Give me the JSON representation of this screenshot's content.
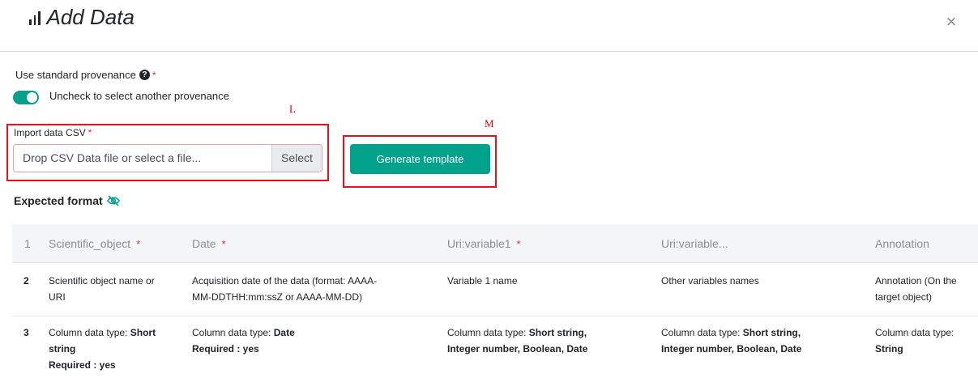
{
  "modal": {
    "title": "Add Data",
    "title_icon": "bar-chart-icon",
    "close_symbol": "×"
  },
  "provenance": {
    "label": "Use standard provenance",
    "required_mark": "*",
    "help_symbol": "?",
    "toggle_label": "Uncheck to select another provenance",
    "toggle_on": true
  },
  "annotations": {
    "L": "L",
    "M": "M"
  },
  "import": {
    "label": "Import data CSV",
    "required_mark": "*",
    "placeholder": "Drop CSV Data file or select a file...",
    "select_label": "Select"
  },
  "generate": {
    "label": "Generate template"
  },
  "expected": {
    "label": "Expected format",
    "icon": "eye-slash-icon"
  },
  "table": {
    "headers": [
      {
        "text": "1",
        "required": ""
      },
      {
        "text": "Scientific_object",
        "required": "*"
      },
      {
        "text": "Date",
        "required": "*"
      },
      {
        "text": "Uri:variable1",
        "required": "*"
      },
      {
        "text": "Uri:variable...",
        "required": ""
      },
      {
        "text": "Annotation",
        "required": ""
      }
    ],
    "row2": {
      "num": "2",
      "c1": [
        "Scientific object name or",
        "URI"
      ],
      "c2": [
        "Acquisition date of the data (format: AAAA-",
        "MM-DDTHH:mm:ssZ or AAAA-MM-DD)"
      ],
      "c3": "Variable 1 name",
      "c4": "Other variables names",
      "c5": [
        "Annotation (On the",
        "target object)"
      ]
    },
    "row3": {
      "num": "3",
      "type_label": "Column data type:",
      "required_label": "Required : yes",
      "c1_type_a": "Short",
      "c1_type_b": "string",
      "c2_type": "Date",
      "c3_type_a": "Short string,",
      "c3_type_b": "Integer number, Boolean, Date",
      "c4_type_a": "Short string,",
      "c4_type_b": "Integer number, Boolean, Date",
      "c5_type": "String"
    }
  },
  "colors": {
    "accent": "#00a28c",
    "required": "#e02b2b",
    "annotation_box": "#e8101a"
  }
}
